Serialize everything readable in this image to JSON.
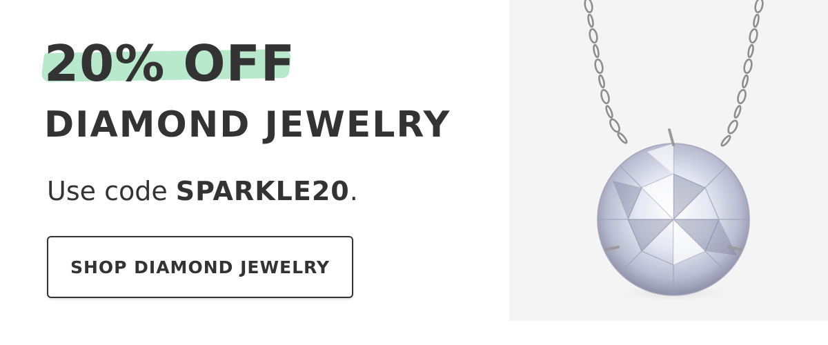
{
  "promo": {
    "headline_discount": "20% OFF",
    "headline_category": "DIAMOND JEWELRY",
    "code_prefix": "Use code ",
    "code": "SPARKLE20",
    "code_suffix": ".",
    "cta_label": "SHOP DIAMOND JEWELRY"
  },
  "product_image": {
    "icon": "diamond-solitaire-necklace"
  },
  "colors": {
    "text": "#333333",
    "highlight": "#b5e8c9",
    "image_background": "#f4f4f4",
    "button_border": "#333333"
  }
}
